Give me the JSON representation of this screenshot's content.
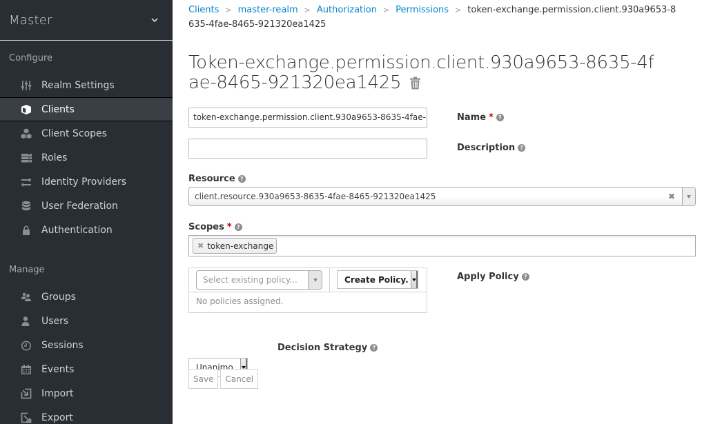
{
  "sidebar": {
    "realm": "Master",
    "sections": {
      "configure": "Configure",
      "manage": "Manage"
    },
    "configure_items": [
      {
        "label": "Realm Settings",
        "icon": "sliders-icon",
        "active": false
      },
      {
        "label": "Clients",
        "icon": "cube-icon",
        "active": true
      },
      {
        "label": "Client Scopes",
        "icon": "cubes-icon",
        "active": false
      },
      {
        "label": "Roles",
        "icon": "server-icon",
        "active": false
      },
      {
        "label": "Identity Providers",
        "icon": "exchange-icon",
        "active": false
      },
      {
        "label": "User Federation",
        "icon": "database-icon",
        "active": false
      },
      {
        "label": "Authentication",
        "icon": "lock-icon",
        "active": false
      }
    ],
    "manage_items": [
      {
        "label": "Groups",
        "icon": "users-icon"
      },
      {
        "label": "Users",
        "icon": "user-icon"
      },
      {
        "label": "Sessions",
        "icon": "clock-icon"
      },
      {
        "label": "Events",
        "icon": "calendar-icon"
      },
      {
        "label": "Import",
        "icon": "import-icon"
      },
      {
        "label": "Export",
        "icon": "export-icon"
      }
    ]
  },
  "breadcrumb": {
    "items": [
      "Clients",
      "master-realm",
      "Authorization",
      "Permissions"
    ],
    "current": "token-exchange.permission.client.930a9653-8635-4fae-8465-921320ea1425"
  },
  "page": {
    "title": "Token-exchange.permission.client.930a9653-8635-4fae-8465-921320ea1425"
  },
  "form": {
    "name": {
      "label": "Name",
      "value": "token-exchange.permission.client.930a9653-8635-4fae-8465-921320ea1425",
      "required": true
    },
    "description": {
      "label": "Description",
      "value": ""
    },
    "resource": {
      "label": "Resource",
      "value": "client.resource.930a9653-8635-4fae-8465-921320ea1425"
    },
    "scopes": {
      "label": "Scopes",
      "tags": [
        "token-exchange"
      ],
      "required": true
    },
    "apply_policy": {
      "label": "Apply Policy",
      "select_placeholder": "Select existing policy...",
      "create_label": "Create Policy.",
      "empty_text": "No policies assigned."
    },
    "decision_strategy": {
      "label": "Decision Strategy",
      "value": "Unanimo"
    },
    "save_label": "Save",
    "cancel_label": "Cancel"
  },
  "colors": {
    "sidebar_bg": "#292e34",
    "link": "#0088ce",
    "required": "#cc0000"
  }
}
